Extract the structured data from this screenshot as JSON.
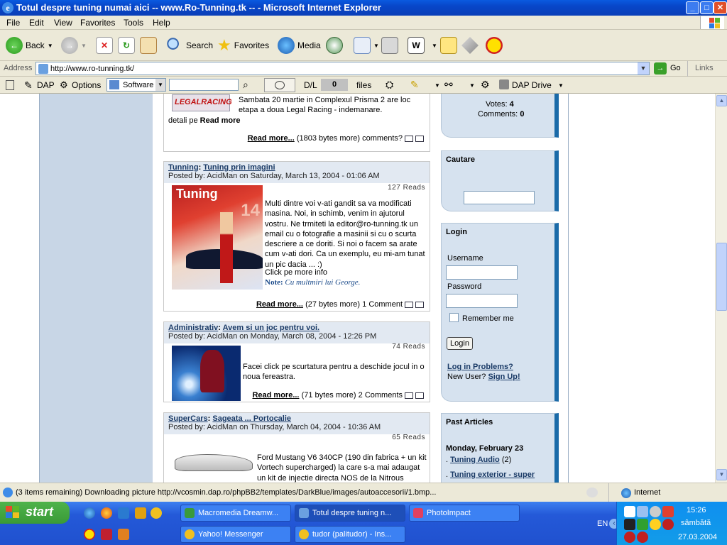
{
  "window": {
    "title": "Totul despre tuning numai aici -- www.Ro-Tunning.tk -- - Microsoft Internet Explorer",
    "buttons": {
      "min": "_",
      "max": "□",
      "close": "✕"
    }
  },
  "menu": [
    "File",
    "Edit",
    "View",
    "Favorites",
    "Tools",
    "Help"
  ],
  "toolbar": {
    "back": "Back",
    "search": "Search",
    "favorites": "Favorites",
    "media": "Media"
  },
  "address": {
    "label": "Address",
    "url": "http://www.ro-tunning.tk/",
    "go": "Go",
    "links": "Links"
  },
  "dap": {
    "dap": "DAP",
    "options": "Options",
    "software": "Software",
    "dl": "D/L",
    "count": "0",
    "files": "files",
    "drive": "DAP Drive"
  },
  "page": {
    "top_post": {
      "logo": "LEGALRACING",
      "text1": "Sambata 20 martie in Complexul Prisma 2 are loc etapa a doua Legal Racing - indemanare.",
      "text2_prefix": "detali pe ",
      "text2_bold": "Read more",
      "readmore": "Read more...",
      "readmore_tail": "(1803 bytes more) comments?"
    },
    "posts": [
      {
        "category": "Tunning",
        "title": "Tuning prin imagini",
        "posted": "Posted by:  AcidMan on Saturday, March 13, 2004 - 01:06 AM",
        "reads": "127 Reads",
        "image_label": "Tuning",
        "image_number": "14",
        "body": "Multi dintre voi v-ati gandit sa va modificati masina. Noi, in schimb, venim in ajutorul vostru. Ne trmiteti la editor@ro-tunning.tk un email cu o fotografie a masinii si cu o scurta descriere a ce doriti. Si noi o facem sa arate cum v-ati dori. Ca un exemplu, eu mi-am tunat un pic dacia ... :)",
        "body2": "Click pe more info",
        "note_label": "Note:",
        "note_text": "Cu multmiri lui George.",
        "readmore": "Read more...",
        "readmore_tail": "(27 bytes more) 1 Comment"
      },
      {
        "category": "Administrativ",
        "title": "Avem si un joc pentru voi.",
        "posted": "Posted by:  AcidMan on Monday, March 08, 2004 - 12:26 PM",
        "reads": "74 Reads",
        "body": "Facei click pe scurtatura pentru a deschide jocul in o noua fereastra.",
        "readmore": "Read more...",
        "readmore_tail": "(71 bytes more) 2 Comments"
      },
      {
        "category": "SuperCars",
        "title": "Sageata ... Portocalie",
        "posted": "Posted by:  AcidMan on Thursday, March 04, 2004 - 10:36 AM",
        "reads": "65 Reads",
        "body": "Ford Mustang V6 340CP (190 din fabrica + un kit Vortech supercharged) la care s-a mai adaugat un kit de injectie directa NOS de la Nitrous"
      }
    ],
    "sidebar": {
      "votes_label": "Votes:",
      "votes": "4",
      "comments_label": "Comments:",
      "comments": "0",
      "search_title": "Cautare",
      "login_title": "Login",
      "username": "Username",
      "password": "Password",
      "remember": "Remember me",
      "login_btn": "Login",
      "problems": "Log in Problems?",
      "new_user": "New User?",
      "signup": "Sign Up!",
      "past_title": "Past Articles",
      "past_date": "Monday, February 23",
      "past_items": [
        {
          "label": "Tuning Audio",
          "count": "(2)"
        },
        {
          "label": "Tuning exterior - super",
          "count": ""
        }
      ]
    }
  },
  "status": {
    "message": "(3 items remaining) Downloading picture http://vcosmin.dap.ro/phpBB2/templates/DarkBlue/images/autoaccesorii/1.bmp...",
    "zone": "Internet"
  },
  "taskbar": {
    "start": "start",
    "tasks": [
      {
        "label": "Macromedia Dreamw...",
        "active": false
      },
      {
        "label": "Totul despre tuning n...",
        "active": true
      },
      {
        "label": "PhotoImpact",
        "active": false
      },
      {
        "label": "Yahoo! Messenger",
        "active": false
      },
      {
        "label": "tudor (palitudor) - Ins...",
        "active": false
      }
    ],
    "lang": "EN",
    "time": "15:26",
    "day": "sâmbătă",
    "date": "27.03.2004"
  }
}
